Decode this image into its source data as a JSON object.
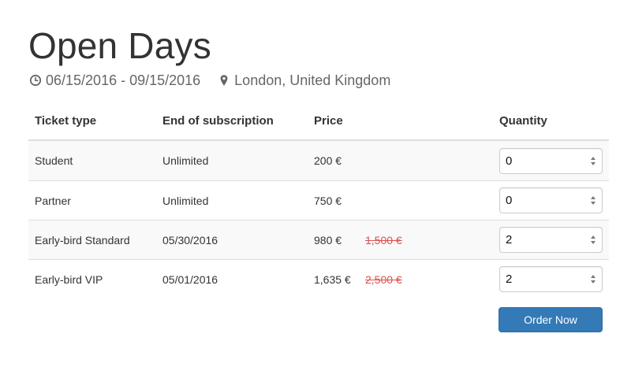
{
  "event": {
    "title": "Open Days",
    "dates": "06/15/2016 - 09/15/2016",
    "location": "London, United Kingdom"
  },
  "icons": {
    "clock": "clock-icon",
    "location": "map-marker-icon",
    "spinner": "up-down-arrows-icon"
  },
  "table": {
    "headers": {
      "type": "Ticket type",
      "end": "End of subscription",
      "price": "Price",
      "quantity": "Quantity"
    },
    "rows": [
      {
        "type": "Student",
        "end": "Unlimited",
        "price": "200 €",
        "old_price": "",
        "quantity": "0"
      },
      {
        "type": "Partner",
        "end": "Unlimited",
        "price": "750 €",
        "old_price": "",
        "quantity": "0"
      },
      {
        "type": "Early-bird Standard",
        "end": "05/30/2016",
        "price": "980 €",
        "old_price": "1,500 €",
        "quantity": "2"
      },
      {
        "type": "Early-bird VIP",
        "end": "05/01/2016",
        "price": "1,635 €",
        "old_price": "2,500 €",
        "quantity": "2"
      }
    ]
  },
  "order_button": "Order Now",
  "colors": {
    "primary": "#337ab7",
    "strikethrough": "#d9534f",
    "muted": "#666666",
    "row_stripe": "#f9f9f9"
  }
}
